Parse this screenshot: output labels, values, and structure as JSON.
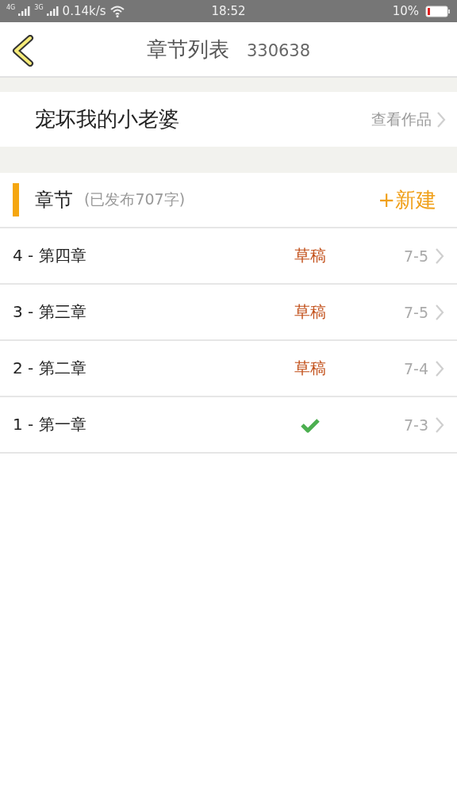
{
  "status_bar": {
    "network_1": "4G",
    "network_2": "3G",
    "speed": "0.14k/s",
    "time": "18:52",
    "battery": "10%"
  },
  "header": {
    "title": "章节列表",
    "id": "330638"
  },
  "book": {
    "title": "宠坏我的小老婆",
    "link": "查看作品"
  },
  "section": {
    "title": "章节",
    "summary": "(已发布707字)",
    "new_button": "+新建"
  },
  "chapters": [
    {
      "title": "4 - 第四章",
      "kind": "draft",
      "status": "草稿",
      "date": "7-5"
    },
    {
      "title": "3 - 第三章",
      "kind": "draft",
      "status": "草稿",
      "date": "7-5"
    },
    {
      "title": "2 - 第二章",
      "kind": "draft",
      "status": "草稿",
      "date": "7-4"
    },
    {
      "title": "1 - 第一章",
      "kind": "published",
      "date": "7-3"
    }
  ]
}
